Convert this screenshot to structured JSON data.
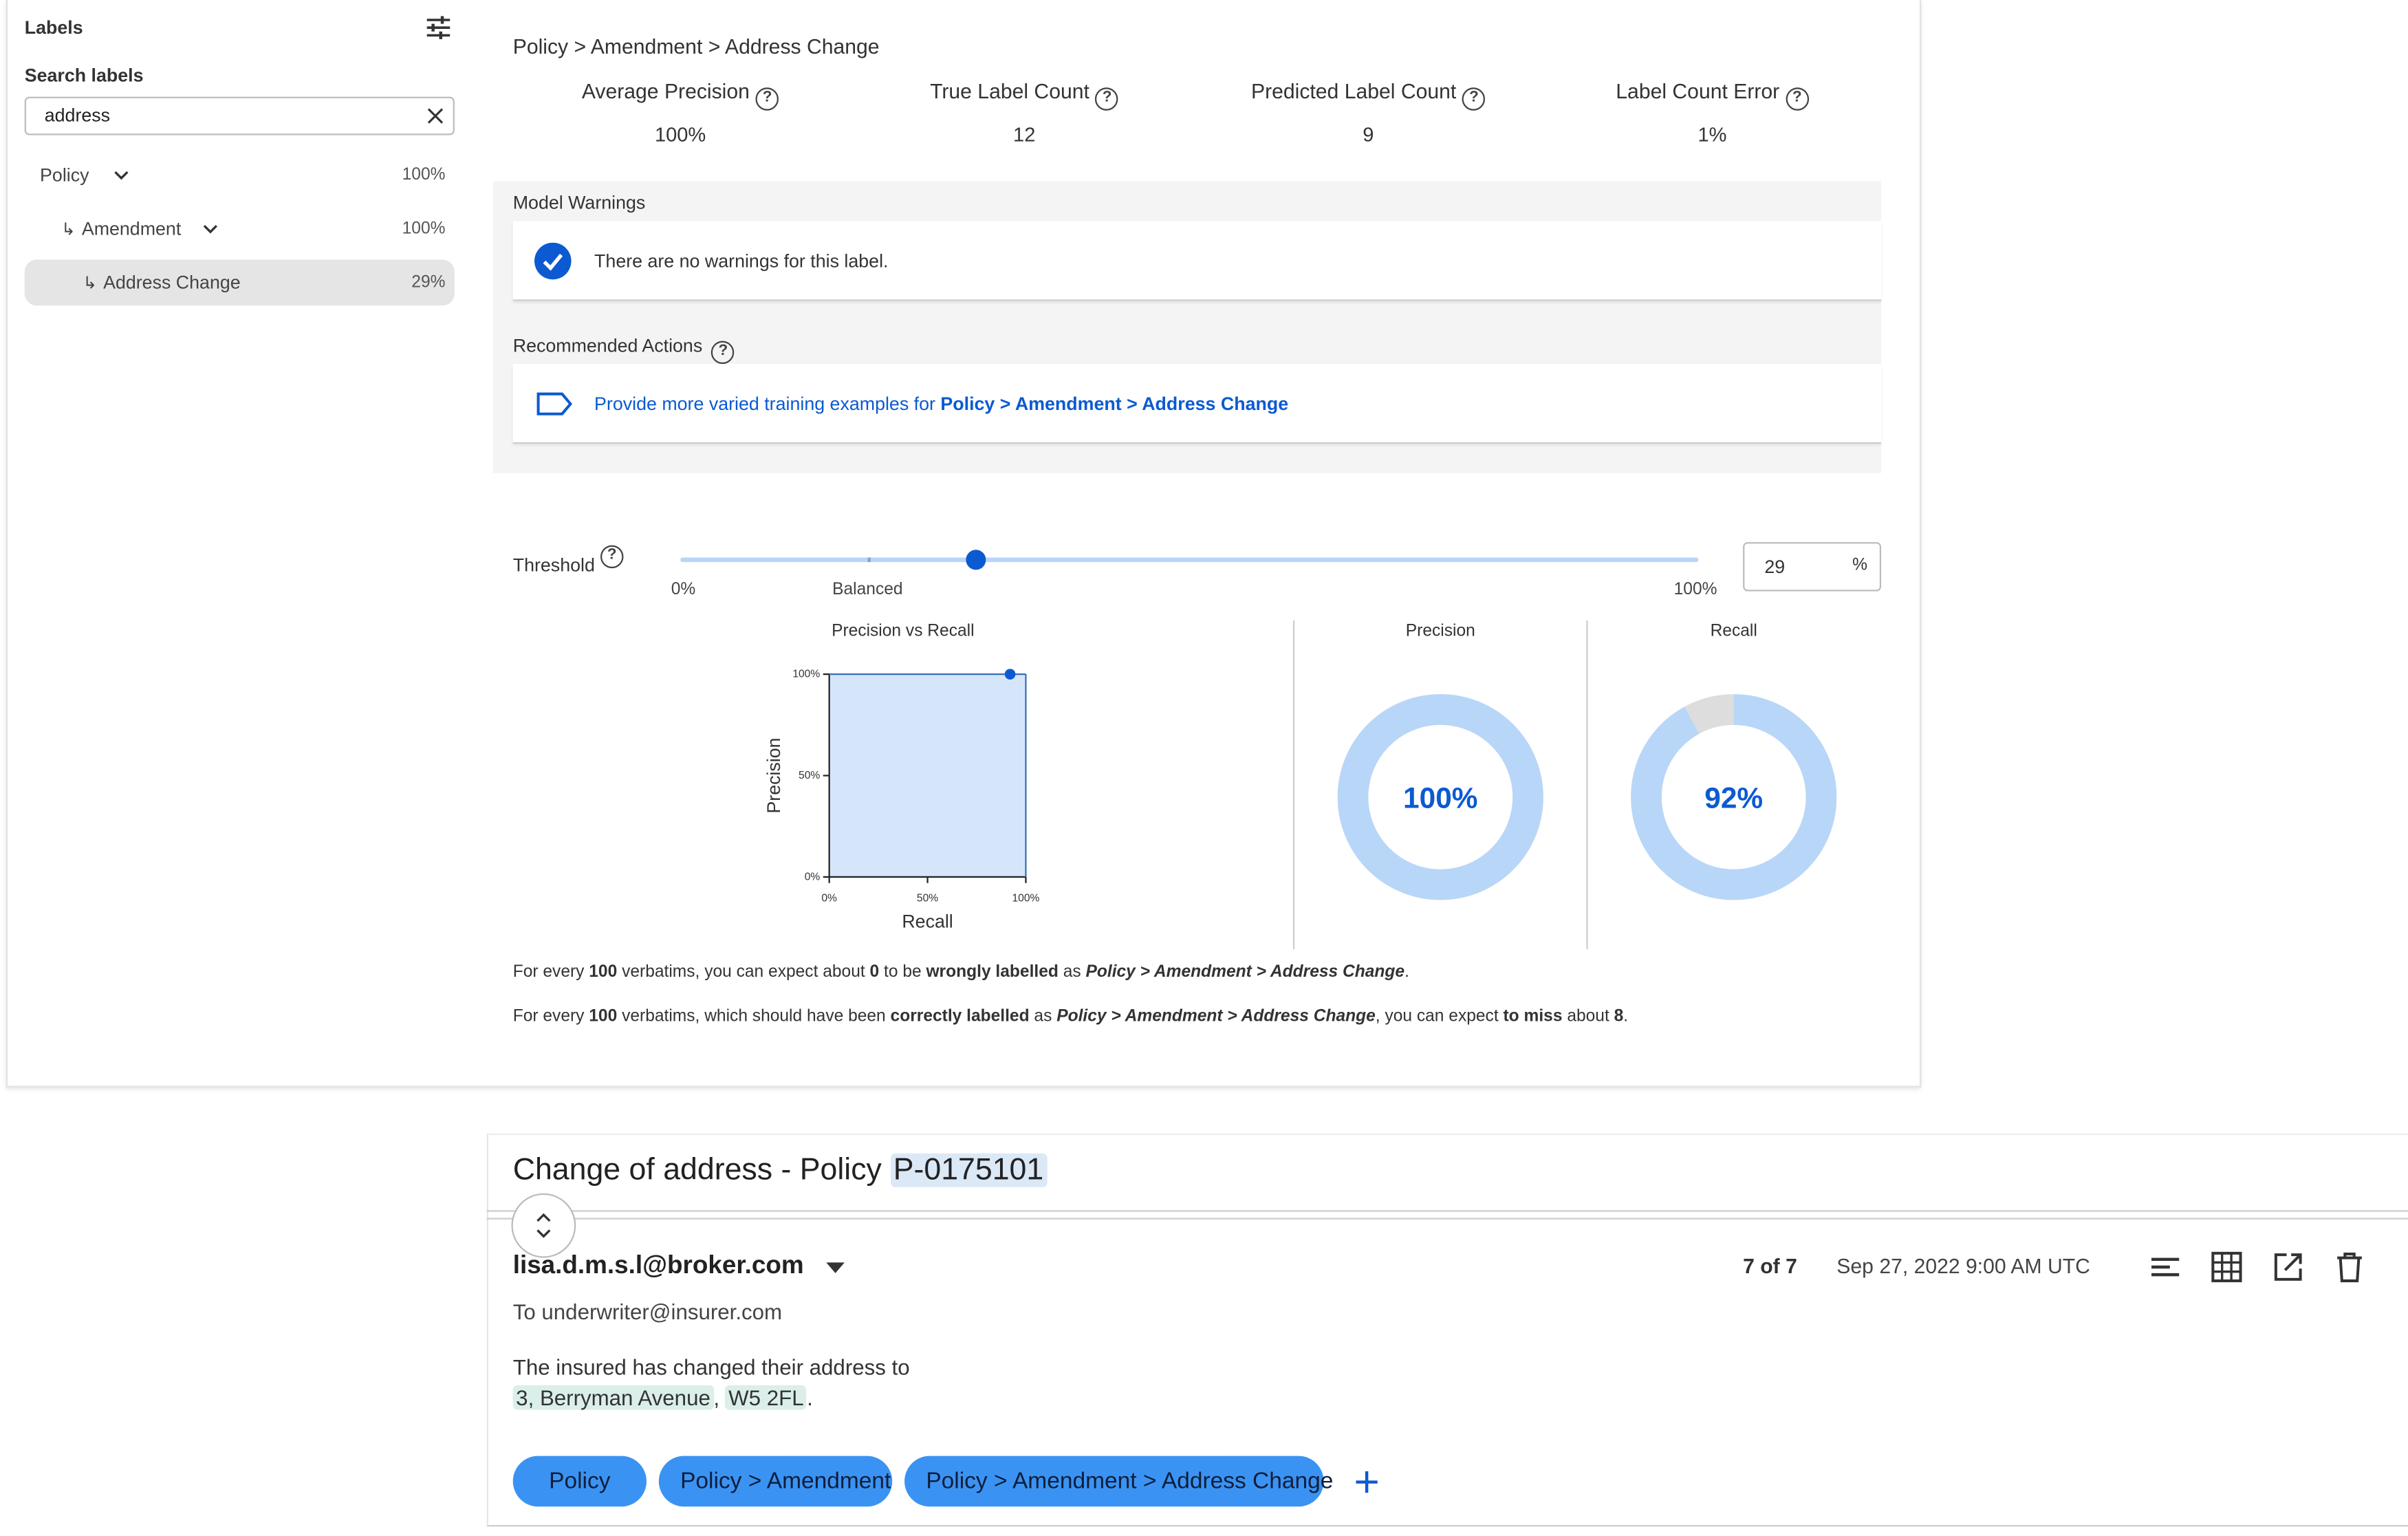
{
  "sidebar": {
    "title": "Labels",
    "search_label": "Search labels",
    "search_value": "address",
    "items": [
      {
        "label": "Policy",
        "pct": "100%"
      },
      {
        "label": "Amendment",
        "pct": "100%"
      },
      {
        "label": "Address Change",
        "pct": "29%"
      }
    ]
  },
  "main": {
    "path": "Policy > Amendment > Address Change",
    "metrics": [
      {
        "label": "Average Precision",
        "value": "100%"
      },
      {
        "label": "True Label Count",
        "value": "12"
      },
      {
        "label": "Predicted Label Count",
        "value": "9"
      },
      {
        "label": "Label Count Error",
        "value": "1%"
      }
    ],
    "warnings_title": "Model Warnings",
    "warnings_text": "There are no warnings for this label.",
    "actions_title": "Recommended Actions",
    "action_prefix": "Provide more varied training examples for ",
    "action_label": "Policy > Amendment > Address Change",
    "threshold_label": "Threshold",
    "threshold_value": "29",
    "threshold_fraction": 0.29,
    "threshold_unit": "%",
    "slider_min": "0%",
    "slider_balanced": "Balanced",
    "slider_max": "100%",
    "pvr_title": "Precision vs Recall",
    "pvr_ylabel": "Precision",
    "pvr_xlabel": "Recall",
    "pvr_yticks": [
      "100%",
      "50%",
      "0%"
    ],
    "pvr_xticks": [
      "0%",
      "50%",
      "100%"
    ],
    "precision_title": "Precision",
    "precision_value": "100%",
    "recall_title": "Recall",
    "recall_value": "92%",
    "s1": {
      "a": "For every ",
      "b": "100",
      "c": " verbatims, you can expect about ",
      "d": "0",
      "e": " to be ",
      "f": "wrongly labelled",
      "g": " as ",
      "h": "Policy > Amendment > Address Change",
      "i": "."
    },
    "s2": {
      "a": "For every ",
      "b": "100",
      "c": " verbatims, which should have been ",
      "d": "correctly labelled",
      "e": " as ",
      "f": "Policy > Amendment > Address Change",
      "g": ", you can expect ",
      "h": "to miss",
      "i": " about ",
      "j": "8",
      "k": "."
    }
  },
  "chart_data": [
    {
      "type": "scatter",
      "title": "Precision vs Recall",
      "xlabel": "Recall",
      "ylabel": "Precision",
      "xlim": [
        0,
        100
      ],
      "ylim": [
        0,
        100
      ],
      "x": [
        92
      ],
      "y": [
        100
      ],
      "area_fill": true
    },
    {
      "type": "pie",
      "title": "Precision",
      "values": [
        100,
        0
      ],
      "center_label": "100%"
    },
    {
      "type": "pie",
      "title": "Recall",
      "values": [
        92,
        8
      ],
      "center_label": "92%"
    }
  ],
  "email": {
    "subject_prefix": "Change of address - Policy ",
    "subject_id": "P-0175101",
    "sender": "lisa.d.m.s.l@broker.com",
    "position": "7 of 7",
    "timestamp": "Sep 27, 2022 9:00 AM UTC",
    "to": "To underwriter@insurer.com",
    "body_line1": "The insured has changed their address to",
    "addr1": "3, Berryman Avenue",
    "comma": ", ",
    "addr2": "W5 2FL",
    "period": ".",
    "chips": [
      "Policy",
      "Policy > Amendment",
      "Policy > Amendment > Address Change"
    ]
  },
  "colors": {
    "accent": "#0b5ad1",
    "chip": "#3a93f3",
    "donut": "#b8d6f8",
    "donut_gap": "#dddddd"
  }
}
